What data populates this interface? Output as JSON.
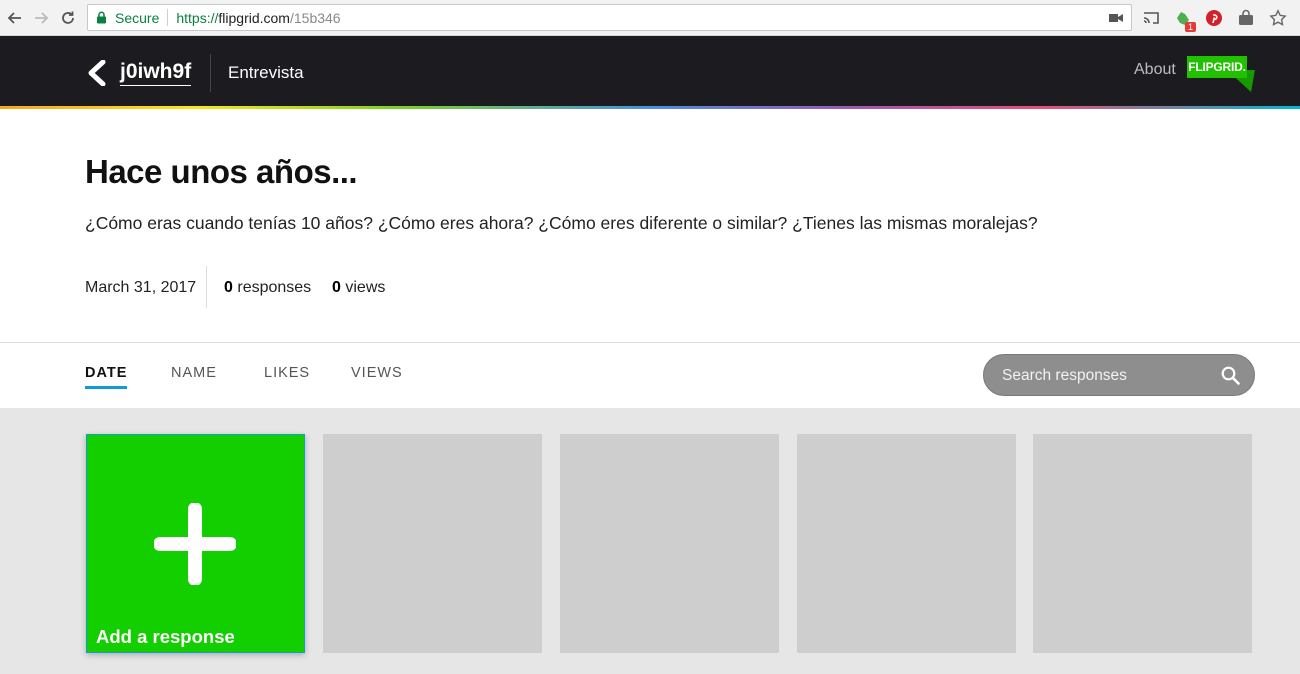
{
  "browser": {
    "secure_label": "Secure",
    "url_scheme": "https://",
    "url_host": "flipgrid.com",
    "url_path": "/15b346",
    "extension_badge": "1"
  },
  "header": {
    "grid_code": "j0iwh9f",
    "grid_name": "Entrevista",
    "about_label": "About",
    "logo_text": "FLIPGRID."
  },
  "topic": {
    "title": "Hace unos años...",
    "description": "¿Cómo eras cuando tenías 10 años? ¿Cómo eres ahora? ¿Cómo eres diferente o similar? ¿Tienes las mismas moralejas?",
    "date": "March 31, 2017",
    "responses_count": "0",
    "responses_label": "responses",
    "views_count": "0",
    "views_label": "views"
  },
  "sort": {
    "tabs": [
      {
        "label": "DATE",
        "active": true
      },
      {
        "label": "NAME",
        "active": false
      },
      {
        "label": "LIKES",
        "active": false
      },
      {
        "label": "VIEWS",
        "active": false
      }
    ],
    "search_placeholder": "Search responses"
  },
  "responses": {
    "add_label": "Add a response"
  },
  "colors": {
    "header_bg": "#1b1b20",
    "accent_green": "#13cf00",
    "tab_underline": "#0e9bd8",
    "secure_green": "#0b8043"
  }
}
